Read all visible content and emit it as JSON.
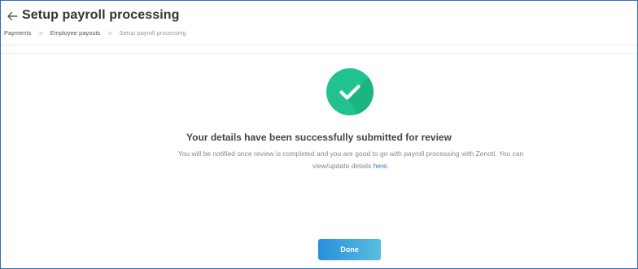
{
  "header": {
    "title": "Setup payroll processing",
    "back_icon": "arrow-left-icon"
  },
  "breadcrumb": {
    "items": [
      "Payments",
      "Employee payouts",
      "Setup payroll processing"
    ],
    "separator": ">"
  },
  "success": {
    "icon": "checkmark-icon",
    "title": "Your details have been successfully submitted for review",
    "message_part1": "You will be notified once review is completed and you are good to go with payroll processing with Zenoti. You can view/update details ",
    "link_text": "here",
    "message_part2": "."
  },
  "actions": {
    "done_label": "Done"
  },
  "colors": {
    "success_green": "#21c28e",
    "link_blue": "#2b7bcf",
    "button_gradient_start": "#2a8fdc",
    "button_gradient_end": "#58bede",
    "frame_border": "#2f6fb5"
  }
}
